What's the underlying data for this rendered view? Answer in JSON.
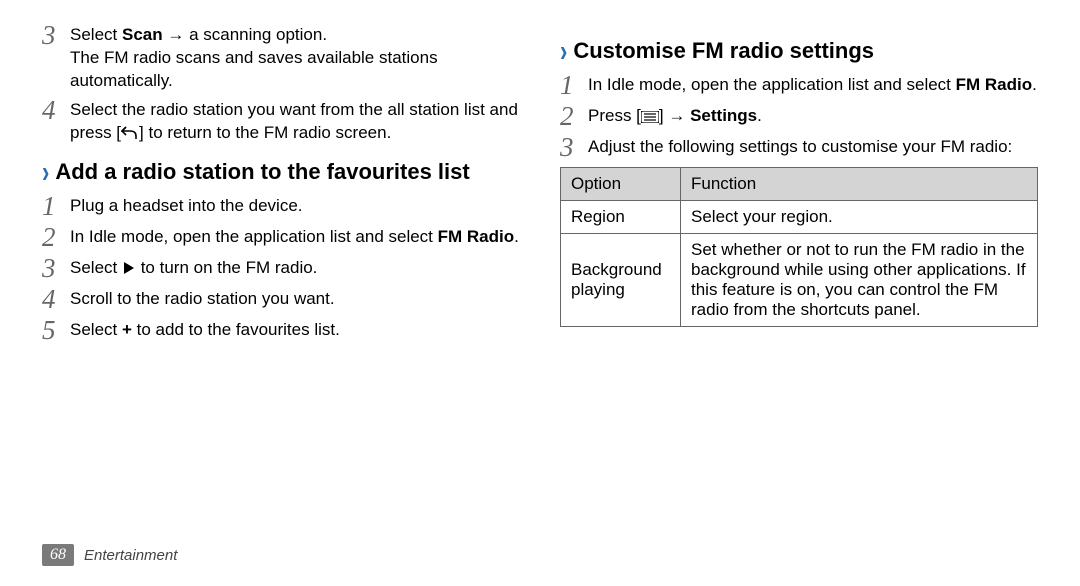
{
  "left": {
    "pre_steps": [
      {
        "n": "3",
        "parts": [
          "Select ",
          {
            "b": "Scan"
          },
          " → a scanning option."
        ],
        "extra": "The FM radio scans and saves available stations automatically."
      },
      {
        "n": "4",
        "parts": [
          "Select the radio station you want from the all station list and press [",
          {
            "icon": "back-icon"
          },
          "] to return to the FM radio screen."
        ]
      }
    ],
    "heading": "Add a radio station to the favourites list",
    "steps": [
      {
        "n": "1",
        "parts": [
          "Plug a headset into the device."
        ]
      },
      {
        "n": "2",
        "parts": [
          "In Idle mode, open the application list and select ",
          {
            "b": "FM Radio"
          },
          "."
        ]
      },
      {
        "n": "3",
        "parts": [
          "Select ",
          {
            "icon": "play-icon"
          },
          " to turn on the FM radio."
        ]
      },
      {
        "n": "4",
        "parts": [
          "Scroll to the radio station you want."
        ]
      },
      {
        "n": "5",
        "parts": [
          "Select ",
          {
            "b": "+"
          },
          " to add to the favourites list."
        ]
      }
    ]
  },
  "right": {
    "heading": "Customise FM radio settings",
    "steps": [
      {
        "n": "1",
        "parts": [
          "In Idle mode, open the application list and select ",
          {
            "b": "FM Radio"
          },
          "."
        ]
      },
      {
        "n": "2",
        "parts": [
          "Press [",
          {
            "icon": "menu-icon"
          },
          "] → ",
          {
            "b": "Settings"
          },
          "."
        ]
      },
      {
        "n": "3",
        "parts": [
          "Adjust the following settings to customise your FM radio:"
        ]
      }
    ],
    "table": {
      "head": [
        "Option",
        "Function"
      ],
      "rows": [
        [
          "Region",
          "Select your region."
        ],
        [
          "Background playing",
          "Set whether or not to run the FM radio in the background while using other applications. If this feature is on, you can control the FM radio from the shortcuts panel."
        ]
      ]
    }
  },
  "footer": {
    "page": "68",
    "section": "Entertainment"
  }
}
